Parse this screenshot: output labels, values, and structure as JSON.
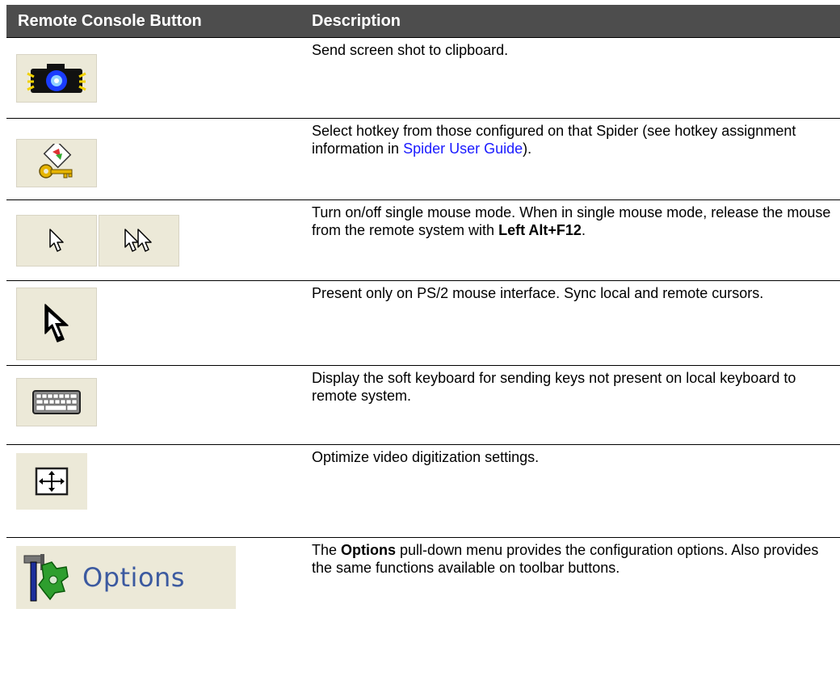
{
  "header": {
    "col1": "Remote Console Button",
    "col2": "Description"
  },
  "rows": [
    {
      "button": "camera-icon",
      "desc": "Send screen shot to clipboard."
    },
    {
      "button": "hotkey-icon",
      "desc_before": "Select hotkey from those configured on that Spider (see hotkey assignment information in ",
      "link": "Spider User Guide",
      "desc_after": ")."
    },
    {
      "button": "single-mouse-icon",
      "desc_before": "Turn on/off single mouse mode. When in single mouse mode, release the mouse from the remote system with ",
      "bold": "Left Alt+F12",
      "desc_after": "."
    },
    {
      "button": "cursor-sync-icon",
      "desc": "Present only on PS/2 mouse interface. Sync local and remote cursors."
    },
    {
      "button": "keyboard-icon",
      "desc": "Display the soft keyboard for sending keys not present on local keyboard to remote system."
    },
    {
      "button": "auto-adjust-icon",
      "desc": "Optimize video digitization settings."
    },
    {
      "button": "options-icon",
      "button_label": "Options",
      "desc_before": "The ",
      "bold": "Options",
      "desc_after": " pull-down menu provides the configuration options. Also provides the same functions available on toolbar buttons."
    }
  ]
}
